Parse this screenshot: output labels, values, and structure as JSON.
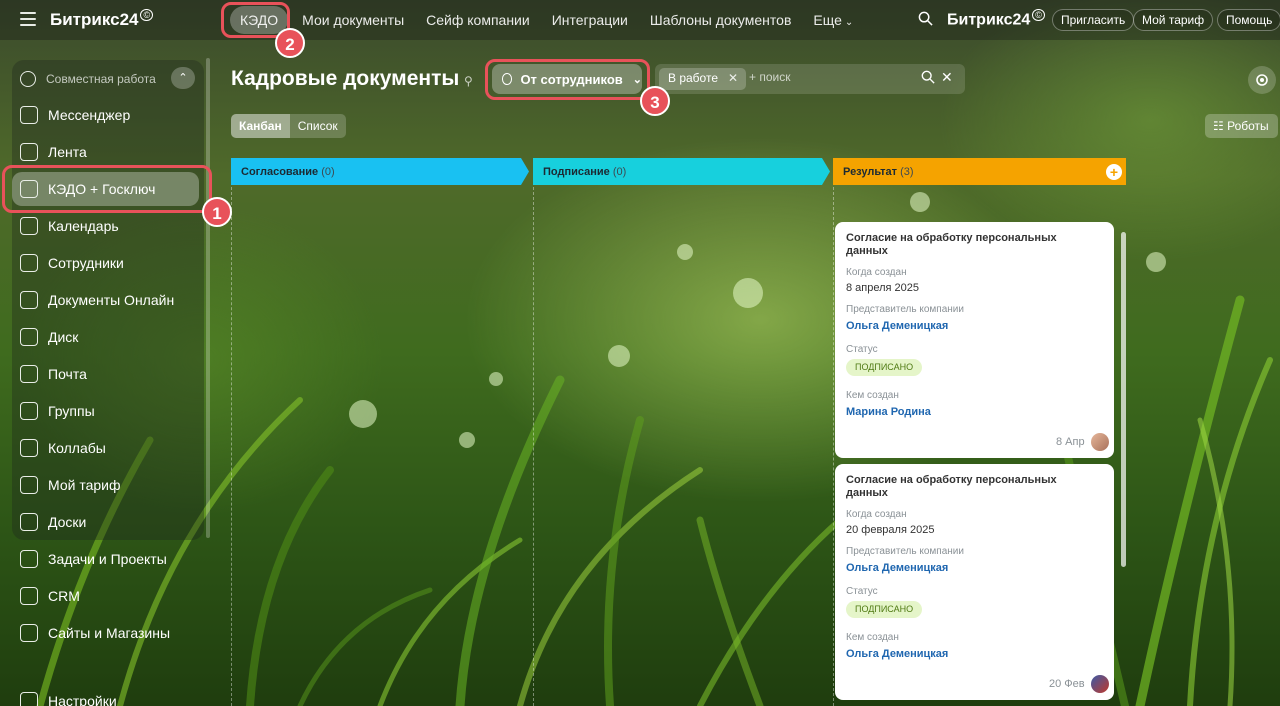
{
  "topbar": {
    "logo": "Битрикс24",
    "logo_mark": "©",
    "nav": [
      {
        "label": "КЭДО"
      },
      {
        "label": "Мои документы"
      },
      {
        "label": "Сейф компании"
      },
      {
        "label": "Интеграции"
      },
      {
        "label": "Шаблоны документов"
      },
      {
        "label": "Еще"
      }
    ],
    "brand": "Битрикс24",
    "brand_mark": "©",
    "invite": "Пригласить",
    "my_plan": "Мой тариф",
    "help": "Помощь"
  },
  "sidebar": {
    "group": "Совместная работа",
    "items": [
      {
        "label": "Мессенджер",
        "icon": "messenger-icon"
      },
      {
        "label": "Лента",
        "icon": "feed-icon"
      },
      {
        "label": "КЭДО + Госключ",
        "icon": "kedo-icon"
      },
      {
        "label": "Календарь",
        "icon": "calendar-icon"
      },
      {
        "label": "Сотрудники",
        "icon": "employees-icon"
      },
      {
        "label": "Документы Онлайн",
        "icon": "documents-icon"
      },
      {
        "label": "Диск",
        "icon": "disk-icon"
      },
      {
        "label": "Почта",
        "icon": "mail-icon"
      },
      {
        "label": "Группы",
        "icon": "groups-icon"
      },
      {
        "label": "Коллабы",
        "icon": "collabs-icon"
      },
      {
        "label": "Мой тариф",
        "icon": "plan-icon"
      },
      {
        "label": "Доски",
        "icon": "boards-icon"
      },
      {
        "label": "Задачи и Проекты",
        "icon": "tasks-icon"
      },
      {
        "label": "CRM",
        "icon": "crm-icon"
      },
      {
        "label": "Сайты и Магазины",
        "icon": "sites-icon"
      },
      {
        "label": "Настройки",
        "icon": "settings-icon"
      }
    ]
  },
  "page": {
    "title": "Кадровые документы",
    "filter_button": "От сотрудников",
    "search_chip": "В работе",
    "search_placeholder": "+ поиск",
    "view_kanban": "Канбан",
    "view_list": "Список",
    "robots": "Роботы"
  },
  "columns": [
    {
      "name": "Согласование",
      "count": "(0)",
      "color": "#19c1f2"
    },
    {
      "name": "Подписание",
      "count": "(0)",
      "color": "#17d0dd"
    },
    {
      "name": "Результат",
      "count": "(3)",
      "color": "#f5a300"
    }
  ],
  "cards": [
    {
      "title": "Согласие на обработку персональных данных",
      "created_label": "Когда создан",
      "created_value": "8 апреля 2025",
      "rep_label": "Представитель компании",
      "rep_value": "Ольга Деменицкая",
      "status_label": "Статус",
      "status_value": "ПОДПИСАНО",
      "author_label": "Кем создан",
      "author_value": "Марина Родина",
      "date": "8 Апр"
    },
    {
      "title": "Согласие на обработку персональных данных",
      "created_label": "Когда создан",
      "created_value": "20 февраля 2025",
      "rep_label": "Представитель компании",
      "rep_value": "Ольга Деменицкая",
      "status_label": "Статус",
      "status_value": "ПОДПИСАНО",
      "author_label": "Кем создан",
      "author_value": "Ольга Деменицкая",
      "date": "20 Фев"
    }
  ],
  "callouts": [
    {
      "number": "1"
    },
    {
      "number": "2"
    },
    {
      "number": "3"
    }
  ],
  "colors": {
    "highlight": "#e8525a",
    "link": "#2067b0",
    "status_bg": "#e5f5c9"
  }
}
